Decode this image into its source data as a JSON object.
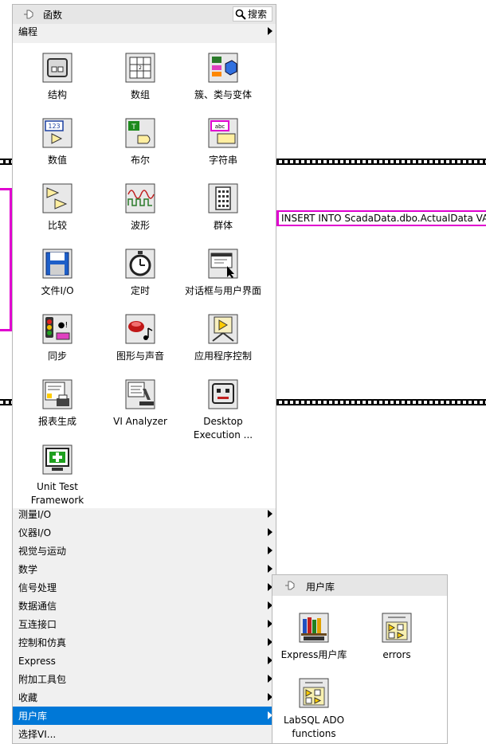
{
  "background": {
    "sql_constant": "INSERT INTO ScadaData.dbo.ActualData VALUES"
  },
  "palette": {
    "title": "函数",
    "search_label": "搜索",
    "top_category": "编程",
    "tiles": [
      {
        "label": "结构",
        "icon": "structures-icon"
      },
      {
        "label": "数组",
        "icon": "array-icon"
      },
      {
        "label": "簇、类与变体",
        "icon": "cluster-class-variant-icon"
      },
      {
        "label": "数值",
        "icon": "numeric-icon"
      },
      {
        "label": "布尔",
        "icon": "boolean-icon"
      },
      {
        "label": "字符串",
        "icon": "string-icon"
      },
      {
        "label": "比较",
        "icon": "comparison-icon"
      },
      {
        "label": "波形",
        "icon": "waveform-icon"
      },
      {
        "label": "群体",
        "icon": "synchronization-group-icon"
      },
      {
        "label": "文件I/O",
        "icon": "file-io-icon"
      },
      {
        "label": "定时",
        "icon": "timing-icon"
      },
      {
        "label": "对话框与用户界面",
        "icon": "dialog-ui-icon"
      },
      {
        "label": "同步",
        "icon": "synchronization-icon"
      },
      {
        "label": "图形与声音",
        "icon": "graphics-sound-icon"
      },
      {
        "label": "应用程序控制",
        "icon": "application-control-icon"
      },
      {
        "label": "报表生成",
        "icon": "report-generation-icon"
      },
      {
        "label": "VI Analyzer",
        "icon": "vi-analyzer-icon"
      },
      {
        "label": "Desktop Execution ...",
        "icon": "desktop-execution-icon"
      },
      {
        "label": "Unit Test Framework",
        "icon": "unit-test-framework-icon"
      }
    ],
    "categories": [
      {
        "label": "测量I/O"
      },
      {
        "label": "仪器I/O"
      },
      {
        "label": "视觉与运动"
      },
      {
        "label": "数学"
      },
      {
        "label": "信号处理"
      },
      {
        "label": "数据通信"
      },
      {
        "label": "互连接口"
      },
      {
        "label": "控制和仿真"
      },
      {
        "label": "Express"
      },
      {
        "label": "附加工具包"
      },
      {
        "label": "收藏"
      },
      {
        "label": "用户库",
        "selected": true
      },
      {
        "label": "选择VI..."
      }
    ]
  },
  "user_library": {
    "title": "用户库",
    "tiles": [
      {
        "label": "Express用户库",
        "icon": "express-user-lib-icon"
      },
      {
        "label": "errors",
        "icon": "errors-lib-icon"
      },
      {
        "label": "LabSQL ADO functions",
        "icon": "labsql-ado-icon"
      }
    ]
  }
}
